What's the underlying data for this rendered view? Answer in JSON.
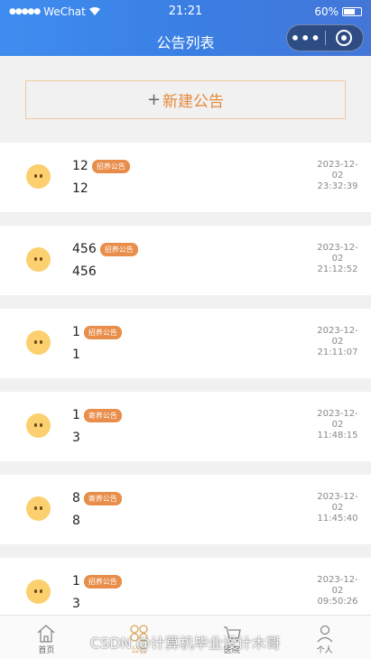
{
  "status_bar": {
    "carrier": "WeChat",
    "time": "21:21",
    "battery": "60%",
    "battery_level": 0.6
  },
  "nav": {
    "title": "公告列表",
    "more_label": "•••"
  },
  "create_button": {
    "plus": "+",
    "label": "新建公告"
  },
  "announcements": [
    {
      "title": "12",
      "tag": "招养公告",
      "content": "12",
      "date": "2023-12-",
      "date2": "02",
      "time": "23:32:39"
    },
    {
      "title": "456",
      "tag": "招养公告",
      "content": "456",
      "date": "2023-12-",
      "date2": "02",
      "time": "21:12:52"
    },
    {
      "title": "1",
      "tag": "招养公告",
      "content": "1",
      "date": "2023-12-",
      "date2": "02",
      "time": "21:11:07"
    },
    {
      "title": "1",
      "tag": "寄养公告",
      "content": "3",
      "date": "2023-12-",
      "date2": "02",
      "time": "11:48:15"
    },
    {
      "title": "8",
      "tag": "寄养公告",
      "content": "8",
      "date": "2023-12-",
      "date2": "02",
      "time": "11:45:40"
    },
    {
      "title": "1",
      "tag": "招养公告",
      "content": "3",
      "date": "2023-12-",
      "date2": "02",
      "time": "09:50:26"
    }
  ],
  "tabbar": [
    {
      "label": "首页",
      "icon": "home-icon"
    },
    {
      "label": "公告",
      "icon": "announcement-icon"
    },
    {
      "label": "医院",
      "icon": "hospital-icon"
    },
    {
      "label": "个人",
      "icon": "user-icon"
    }
  ],
  "watermark": "CSDN @计算机毕业设计木哥",
  "colors": {
    "accent": "#e88d4a",
    "nav_bg": "#3a7fe4",
    "active_tab": "#d9a65c"
  }
}
